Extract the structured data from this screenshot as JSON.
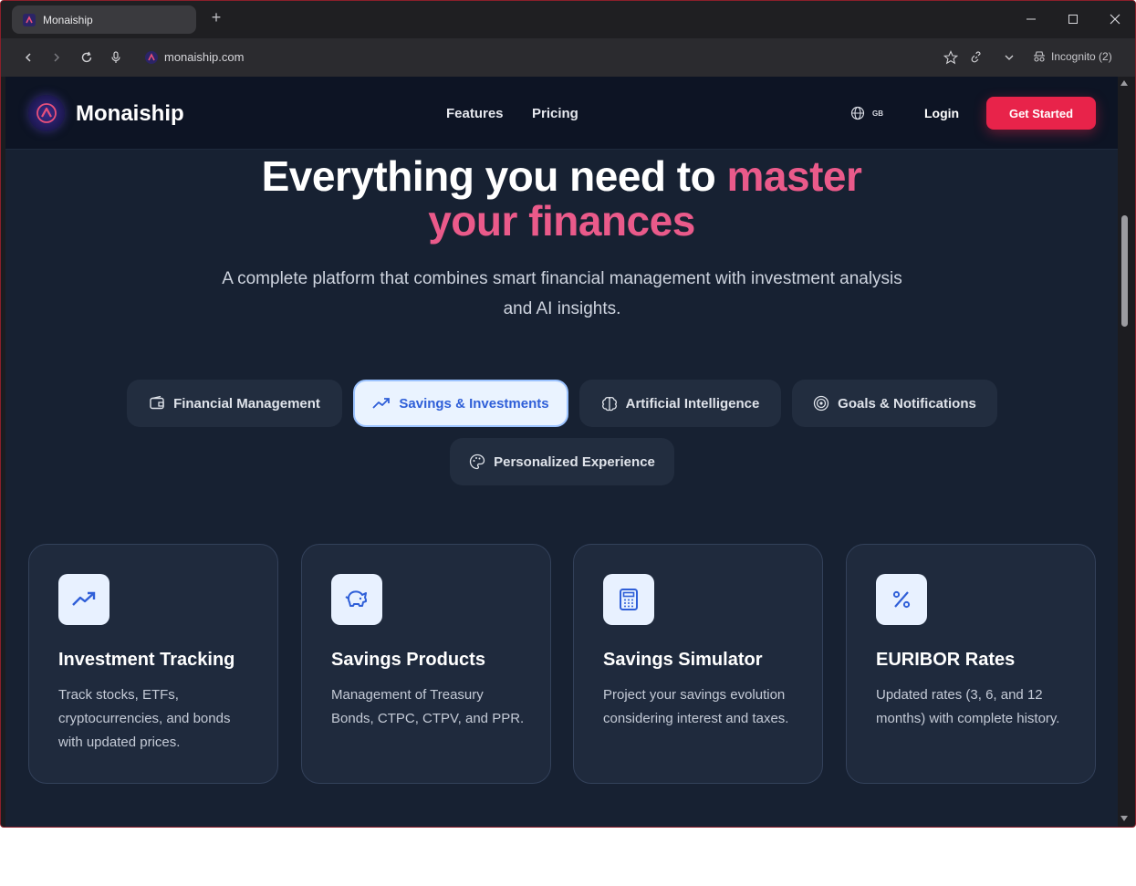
{
  "browser": {
    "tab_title": "Monaiship",
    "url": "monaiship.com",
    "incognito_label": "Incognito (2)"
  },
  "header": {
    "brand": "Monaiship",
    "nav": [
      {
        "label": "Features"
      },
      {
        "label": "Pricing"
      }
    ],
    "lang_code": "GB",
    "login": "Login",
    "cta": "Get Started"
  },
  "hero": {
    "title_plain": "Everything you need to ",
    "title_accent_1": "master",
    "title_accent_2": "your finances",
    "subtitle": "A complete platform that combines smart financial management with investment analysis and AI insights."
  },
  "tabs": [
    {
      "label": "Financial Management",
      "icon": "wallet-icon",
      "active": false
    },
    {
      "label": "Savings & Investments",
      "icon": "trending-up-icon",
      "active": true
    },
    {
      "label": "Artificial Intelligence",
      "icon": "brain-icon",
      "active": false
    },
    {
      "label": "Goals & Notifications",
      "icon": "target-icon",
      "active": false
    },
    {
      "label": "Personalized Experience",
      "icon": "palette-icon",
      "active": false
    }
  ],
  "cards": [
    {
      "title": "Investment Tracking",
      "text": "Track stocks, ETFs, cryptocurrencies, and bonds with updated prices.",
      "icon": "trending-up-icon"
    },
    {
      "title": "Savings Products",
      "text": "Management of Treasury Bonds, CTPC, CTPV, and PPR.",
      "icon": "piggy-bank-icon"
    },
    {
      "title": "Savings Simulator",
      "text": "Project your savings evolution considering interest and taxes.",
      "icon": "calculator-icon"
    },
    {
      "title": "EURIBOR Rates",
      "text": "Updated rates (3, 6, and 12 months) with complete history.",
      "icon": "percent-icon"
    }
  ],
  "colors": {
    "accent_pink": "#ea5a8a",
    "cta_red": "#e8234a",
    "active_tab_text": "#2f5fd8",
    "background": "#172132"
  }
}
